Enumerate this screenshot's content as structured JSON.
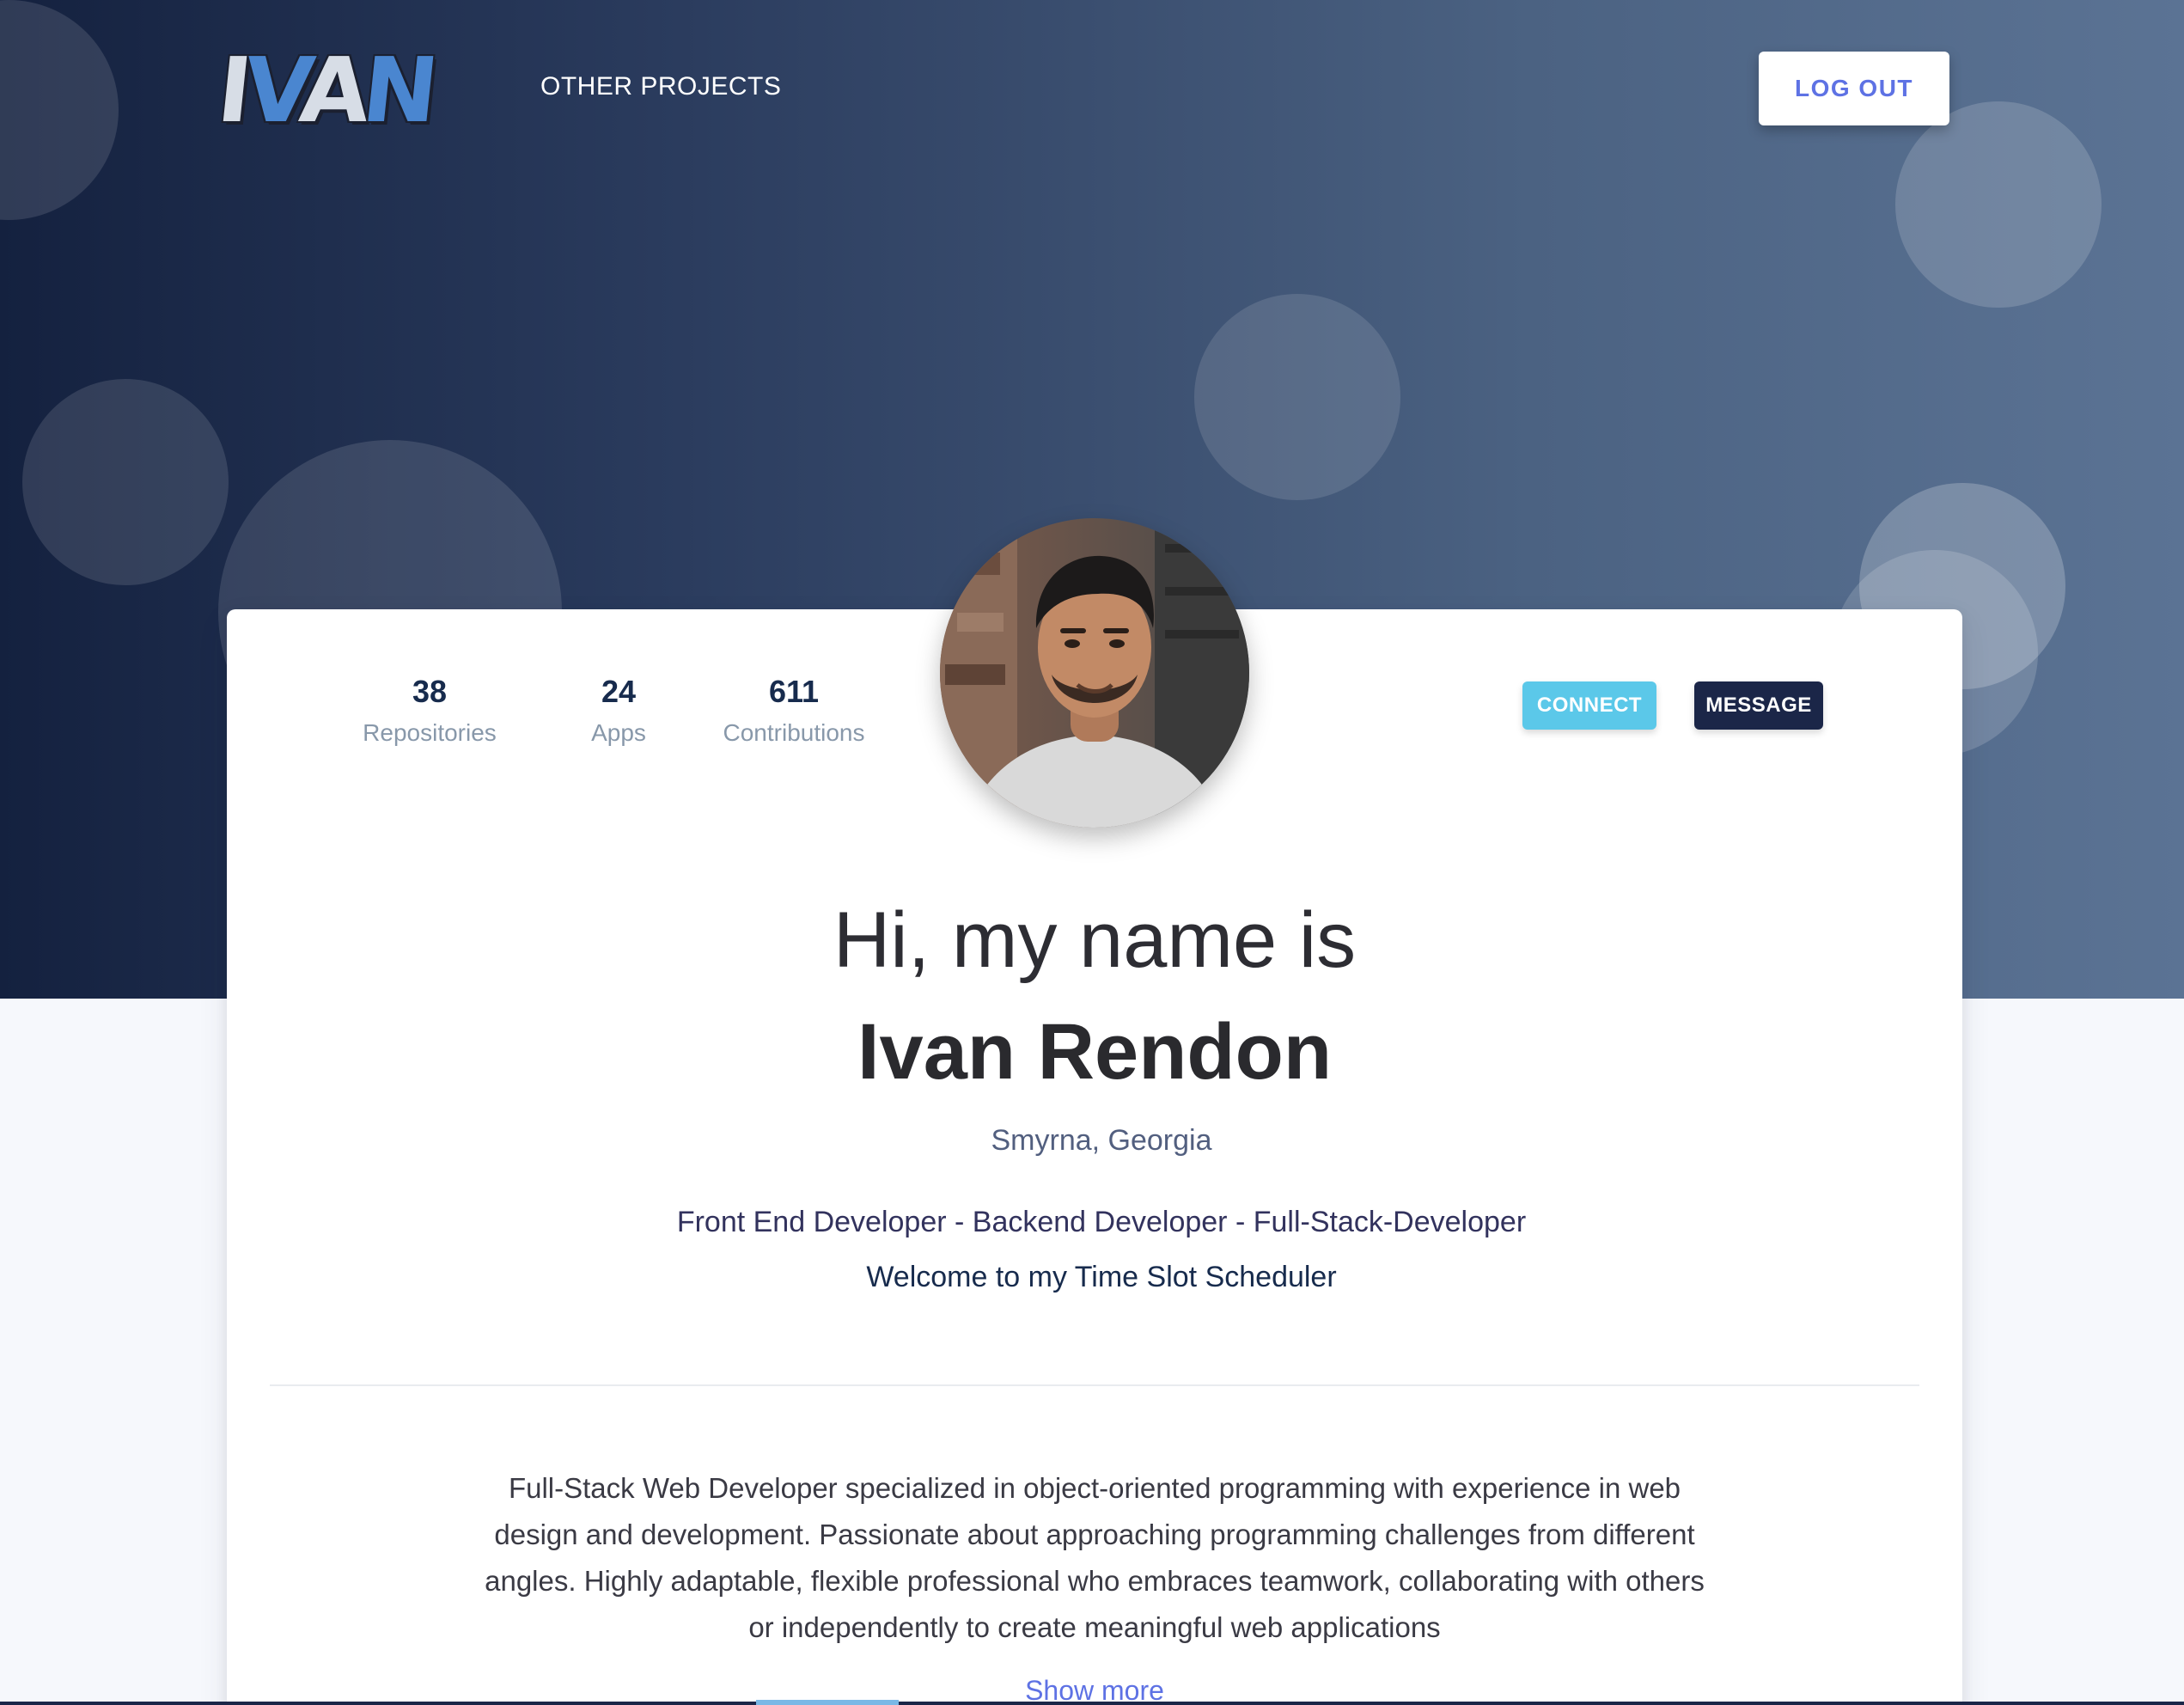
{
  "nav": {
    "logo_text": "IVAN",
    "other_projects_label": "OTHER PROJECTS",
    "logout_label": "LOG OUT"
  },
  "stats": [
    {
      "value": "38",
      "label": "Repositories"
    },
    {
      "value": "24",
      "label": "Apps"
    },
    {
      "value": "611",
      "label": "Contributions"
    }
  ],
  "actions": {
    "connect_label": "CONNECT",
    "message_label": "MESSAGE"
  },
  "profile": {
    "greeting": "Hi, my name is",
    "name": "Ivan Rendon",
    "location": "Smyrna, Georgia",
    "roles": "Front End Developer - Backend Developer - Full-Stack-Developer",
    "welcome": "Welcome to my Time Slot Scheduler",
    "bio": "Full-Stack Web Developer specialized in object-oriented programming with experience in web design and development. Passionate about approaching programming challenges from different angles. Highly adaptable, flexible professional who embraces teamwork, collaborating with others or independently to create meaningful web applications",
    "show_more_label": "Show more"
  },
  "colors": {
    "hero_dark": "#14213f",
    "hero_light": "#5b7394",
    "accent": "#5e72e4",
    "connect": "#5bc8e9",
    "message": "#1b2648"
  }
}
